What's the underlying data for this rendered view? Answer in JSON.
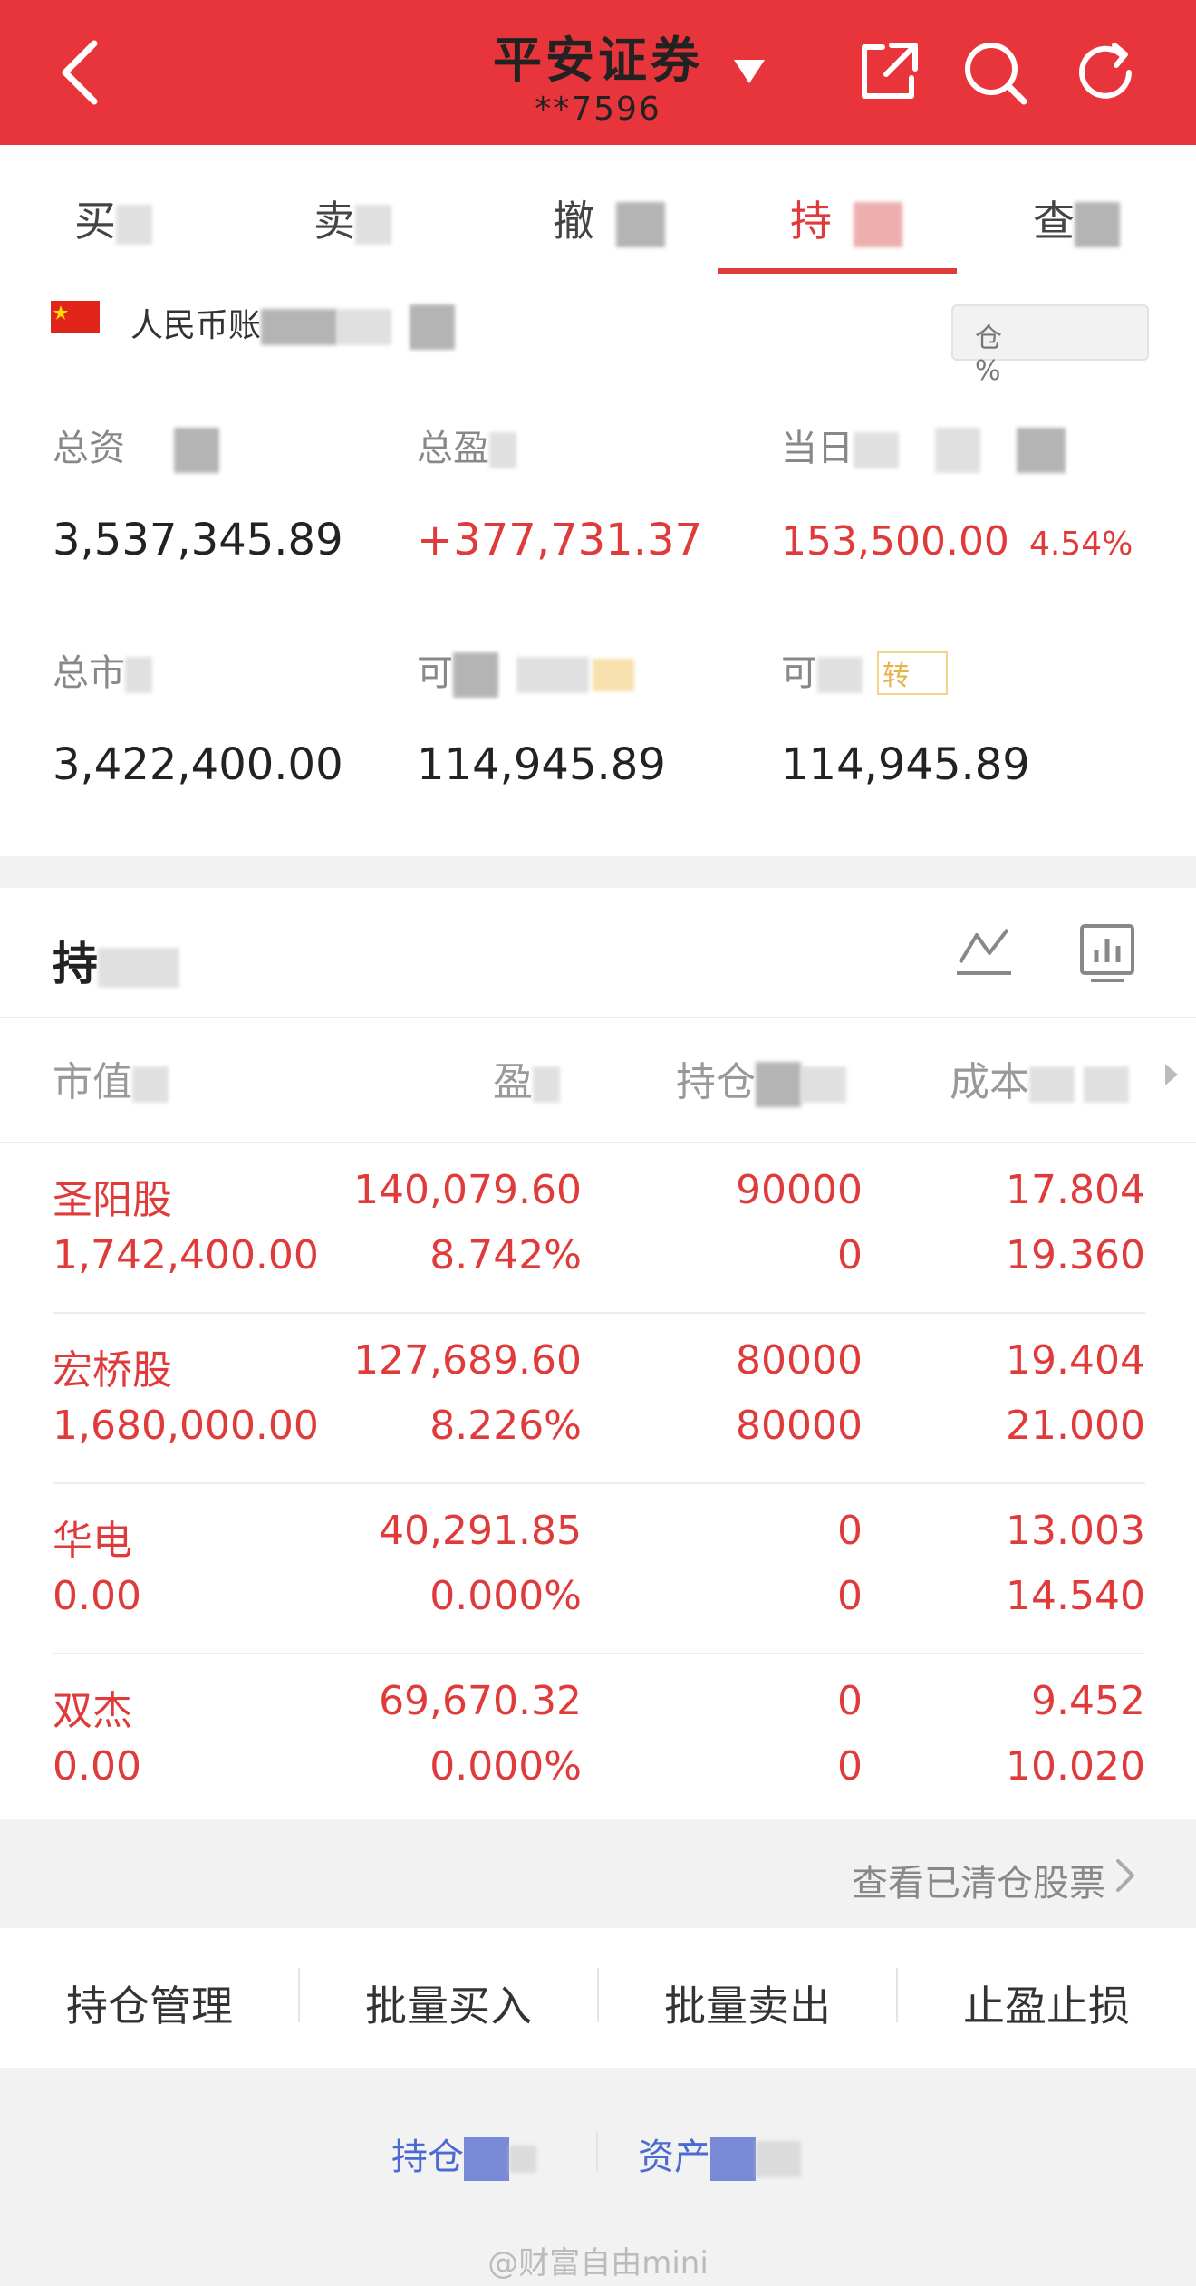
{
  "header": {
    "title": "平安证券",
    "account": "**7596",
    "accent": "#e8353c"
  },
  "tabs": [
    {
      "label": "买"
    },
    {
      "label": "卖"
    },
    {
      "label": "撤"
    },
    {
      "label": "持",
      "active": true
    },
    {
      "label": "查"
    }
  ],
  "account_card": {
    "currency_label": "人民币账",
    "position_badge": "仓 %",
    "total_assets": {
      "label": "总资",
      "value": "3,537,345.89"
    },
    "total_profit": {
      "label": "总盈",
      "value": "+377,731.37"
    },
    "today_profit": {
      "label": "当日",
      "value": "153,500.00",
      "percent": "4.54%"
    },
    "total_market": {
      "label": "总市",
      "value": "3,422,400.00"
    },
    "available": {
      "label": "可",
      "value": "114,945.89"
    },
    "withdrawable": {
      "label": "可",
      "value": "114,945.89",
      "tag": "转"
    }
  },
  "holdings": {
    "title": "持",
    "columns": [
      "市值",
      "盈",
      "持仓",
      "成本"
    ],
    "rows": [
      {
        "name": "圣阳股",
        "market_value": "1,742,400.00",
        "profit": "140,079.60",
        "profit_pct": "8.742%",
        "position": "90000",
        "available": "0",
        "cost": "17.804",
        "price": "19.360"
      },
      {
        "name": "宏桥股",
        "market_value": "1,680,000.00",
        "profit": "127,689.60",
        "profit_pct": "8.226%",
        "position": "80000",
        "available": "80000",
        "cost": "19.404",
        "price": "21.000"
      },
      {
        "name": "华电",
        "market_value": "0.00",
        "profit": "40,291.85",
        "profit_pct": "0.000%",
        "position": "0",
        "available": "0",
        "cost": "13.003",
        "price": "14.540"
      },
      {
        "name": "双杰",
        "market_value": "0.00",
        "profit": "69,670.32",
        "profit_pct": "0.000%",
        "position": "0",
        "available": "0",
        "cost": "9.452",
        "price": "10.020"
      }
    ]
  },
  "cleared_link": "查看已清仓股票",
  "actions": [
    "持仓管理",
    "批量买入",
    "批量卖出",
    "止盈止损"
  ],
  "bottom_links": [
    "持仓",
    "资产"
  ],
  "watermark": "@财富自由mini"
}
